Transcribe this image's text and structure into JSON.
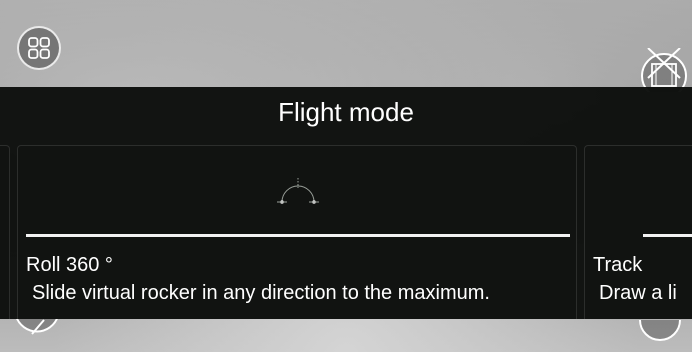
{
  "panel": {
    "title": "Flight mode"
  },
  "modes": [
    {
      "name": "Roll 360 °",
      "description": "Slide virtual rocker in any direction to the maximum."
    },
    {
      "name": "Track",
      "description": "Draw a li"
    }
  ],
  "icons": {
    "top_left": "grid-menu-icon",
    "top_right": "film-disabled-icon",
    "bottom_left": "compass-icon",
    "bottom_right": "control-icon",
    "card_illustration": "roll-arc-icon"
  },
  "colors": {
    "panel_bg": "#0c0e0c",
    "text": "#ffffff",
    "card_border": "#2c2e2c"
  }
}
